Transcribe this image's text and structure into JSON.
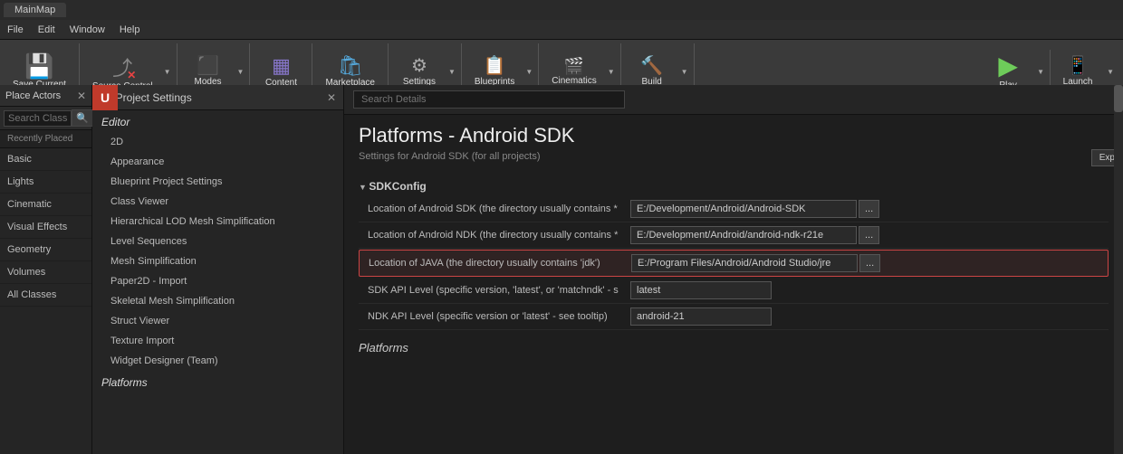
{
  "titleBar": {
    "tabLabel": "MainMap"
  },
  "menuBar": {
    "items": [
      "File",
      "Edit",
      "Window",
      "Help"
    ]
  },
  "toolbar": {
    "saveCurrent": {
      "label": "Save Current",
      "icon": "💾"
    },
    "sourceControl": {
      "label": "Source Control",
      "icon": "⤴"
    },
    "modes": {
      "label": "Modes",
      "icon": "⬛"
    },
    "content": {
      "label": "Content",
      "icon": "▦"
    },
    "marketplace": {
      "label": "Marketplace",
      "icon": "🛍"
    },
    "settings": {
      "label": "Settings",
      "icon": "⚙"
    },
    "blueprints": {
      "label": "Blueprints",
      "icon": "📋"
    },
    "cinematics": {
      "label": "Cinematics",
      "icon": "🎬"
    },
    "build": {
      "label": "Build",
      "icon": "🔨"
    },
    "play": {
      "label": "Play",
      "icon": "▶"
    },
    "launch": {
      "label": "Launch",
      "icon": "📱"
    }
  },
  "placeActors": {
    "header": "Place Actors",
    "searchPlaceholder": "Search Classes",
    "recentlyPlaced": "Recently Placed",
    "navItems": [
      "Basic",
      "Lights",
      "Cinematic",
      "Visual Effects",
      "Geometry",
      "Volumes",
      "All Classes"
    ]
  },
  "projectSettings": {
    "title": "Project Settings",
    "editorSection": "Editor",
    "navItems": [
      "2D",
      "Appearance",
      "Blueprint Project Settings",
      "Class Viewer",
      "Hierarchical LOD Mesh Simplification",
      "Level Sequences",
      "Mesh Simplification",
      "Paper2D - Import",
      "Skeletal Mesh Simplification",
      "Struct Viewer",
      "Texture Import",
      "Widget Designer (Team)"
    ],
    "platformsSection": "Platforms"
  },
  "mainContent": {
    "searchPlaceholder": "Search Details",
    "sectionTitle": "Platforms - Android SDK",
    "sectionSubtitle": "Settings for Android SDK (for all projects)",
    "expandButton": "Exp",
    "sdkConfig": {
      "header": "SDKConfig",
      "rows": [
        {
          "label": "Location of Android SDK (the directory usually contains *",
          "value": "E:/Development/Android/Android-SDK",
          "hasBrowse": true,
          "highlighted": false
        },
        {
          "label": "Location of Android NDK (the directory usually contains *",
          "value": "E:/Development/Android/android-ndk-r21e",
          "hasBrowse": true,
          "highlighted": false
        },
        {
          "label": "Location of JAVA (the directory usually contains 'jdk')",
          "value": "E:/Program Files/Android/Android Studio/jre",
          "hasBrowse": true,
          "highlighted": true
        },
        {
          "label": "SDK API Level (specific version, 'latest', or 'matchndk' - s",
          "value": "latest",
          "hasBrowse": false,
          "highlighted": false
        },
        {
          "label": "NDK API Level (specific version or 'latest' - see tooltip)",
          "value": "android-21",
          "hasBrowse": false,
          "highlighted": false
        }
      ]
    },
    "platformsFooter": "Platforms"
  }
}
